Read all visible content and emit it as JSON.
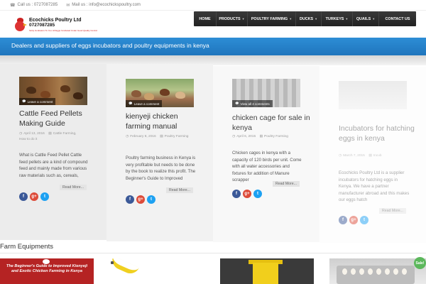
{
  "topbar": {
    "call_label": "Call us : 0727087285",
    "mail_label": "Mail us : info@ecochickspoultry.com"
  },
  "logo": {
    "name": "Ecochicks Poultry Ltd",
    "phone": "0727087285",
    "tagline": "Sicily Incubators To You: All Eggs Incubated Under Good Quality Control"
  },
  "nav": {
    "items": [
      {
        "label": "HOME"
      },
      {
        "label": "PRODUCTS"
      },
      {
        "label": "POULTRY FARMING"
      },
      {
        "label": "DUCKS"
      },
      {
        "label": "TURKEYS"
      },
      {
        "label": "QUAILS"
      },
      {
        "label": "CONTACT US"
      }
    ]
  },
  "banner": {
    "text": "Dealers and suppliers of eggs incubators and poultry equipments in kenya"
  },
  "posts": [
    {
      "comment_label": "Leave a comment",
      "title": "Cattle Feed Pellets Making Guide",
      "date": "April 13, 2016",
      "category": "Cattle Farming,",
      "category2": "How to do it",
      "excerpt": "What is Cattle Feed Pellet Cattle feed pellets are a kind of compound feed and mainly made from various raw materials such as, cereals,",
      "read_more": "Read More..."
    },
    {
      "comment_label": "Leave a comment",
      "title": "kienyeji chicken farming manual",
      "date": "February 8, 2016",
      "category": "Poultry Farming",
      "category2": "",
      "excerpt": "Poultry farming business in Kenya is very profitable but needs to be done by the book to realize this profit. The Beginner's Guide to Improved",
      "read_more": "Read More..."
    },
    {
      "comment_label": "View all 4 comments",
      "title": "chicken cage for sale in kenya",
      "date": "April 6, 2015",
      "category": "Poultry Farming",
      "category2": "",
      "excerpt": "Chicken cages in kenya with a capacity of 120 birds per unit. Come with all water accessories and fixtures for addition of Manure scrapper",
      "read_more": "Read More..."
    },
    {
      "comment_label": "",
      "title": "Incubators for hatching eggs in kenya",
      "date": "March 7, 2015",
      "category": "Incub",
      "category2": "",
      "excerpt": "Ecochicks Poultry Ltd is a supplier incubators for hatching eggs in Kenya. We have a partner manufacturer abroad and this makes our eggs hatch",
      "read_more": "Read More..."
    }
  ],
  "social": {
    "facebook": "f",
    "google": "g+",
    "twitter": "t"
  },
  "equipments": {
    "title": "Farm Equipments",
    "book_text": "The Beginner's Guide to Improved Kienyeji and Exotic Chicken Farming in Kenya",
    "sale_badge": "Sale!"
  },
  "colors": {
    "banner": "#2d8ed6",
    "nav": "#2a2a2a",
    "facebook": "#3b5998",
    "google": "#dd4b39",
    "twitter": "#1da1f2",
    "sale": "#5cb85c"
  }
}
